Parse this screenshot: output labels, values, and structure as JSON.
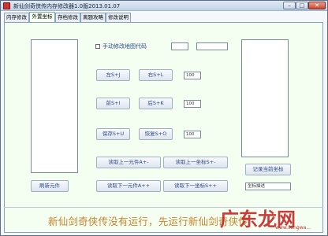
{
  "window": {
    "title": "新仙剑奇侠传内存修改器1.0版2013.01.07",
    "minimize_glyph": "–",
    "maximize_glyph": "□",
    "close_glyph": "✕"
  },
  "tabs": [
    {
      "label": "内存修改"
    },
    {
      "label": "外置坐标"
    },
    {
      "label": "存档修改"
    },
    {
      "label": "离题攻略"
    },
    {
      "label": "修改说明"
    }
  ],
  "options": {
    "manual_map_code_label": "手动修改地图代码"
  },
  "fields": {
    "map_code_1": "",
    "map_code_2": "",
    "value_1": "100",
    "value_2": "100",
    "value_3": "100",
    "coord_desc": "坐标描述"
  },
  "buttons": {
    "up": "左S+J",
    "right": "右S+L",
    "front": "前S+I",
    "back": "后S+K",
    "save": "保存S+U",
    "restore": "恢复S+O",
    "read_prev_component": "读取上一元件A+-",
    "read_prev_coord": "读取上一坐标S+-",
    "read_next_component": "读取下一元件A++",
    "read_next_coord": "读取下一坐标S++",
    "refresh_components": "刷新元件",
    "record_current_coord": "记录当前坐标"
  },
  "status": {
    "message": "新仙剑奇侠传没有运行，先运行新仙剑奇侠传"
  },
  "watermark": {
    "text": "广东龙网",
    "url": "www.ilongwa..."
  },
  "colors": {
    "panel_bg": "#f4fff2",
    "button_text": "#2b4b8a",
    "status_text": "#c8832a",
    "watermark": "#c62828"
  }
}
